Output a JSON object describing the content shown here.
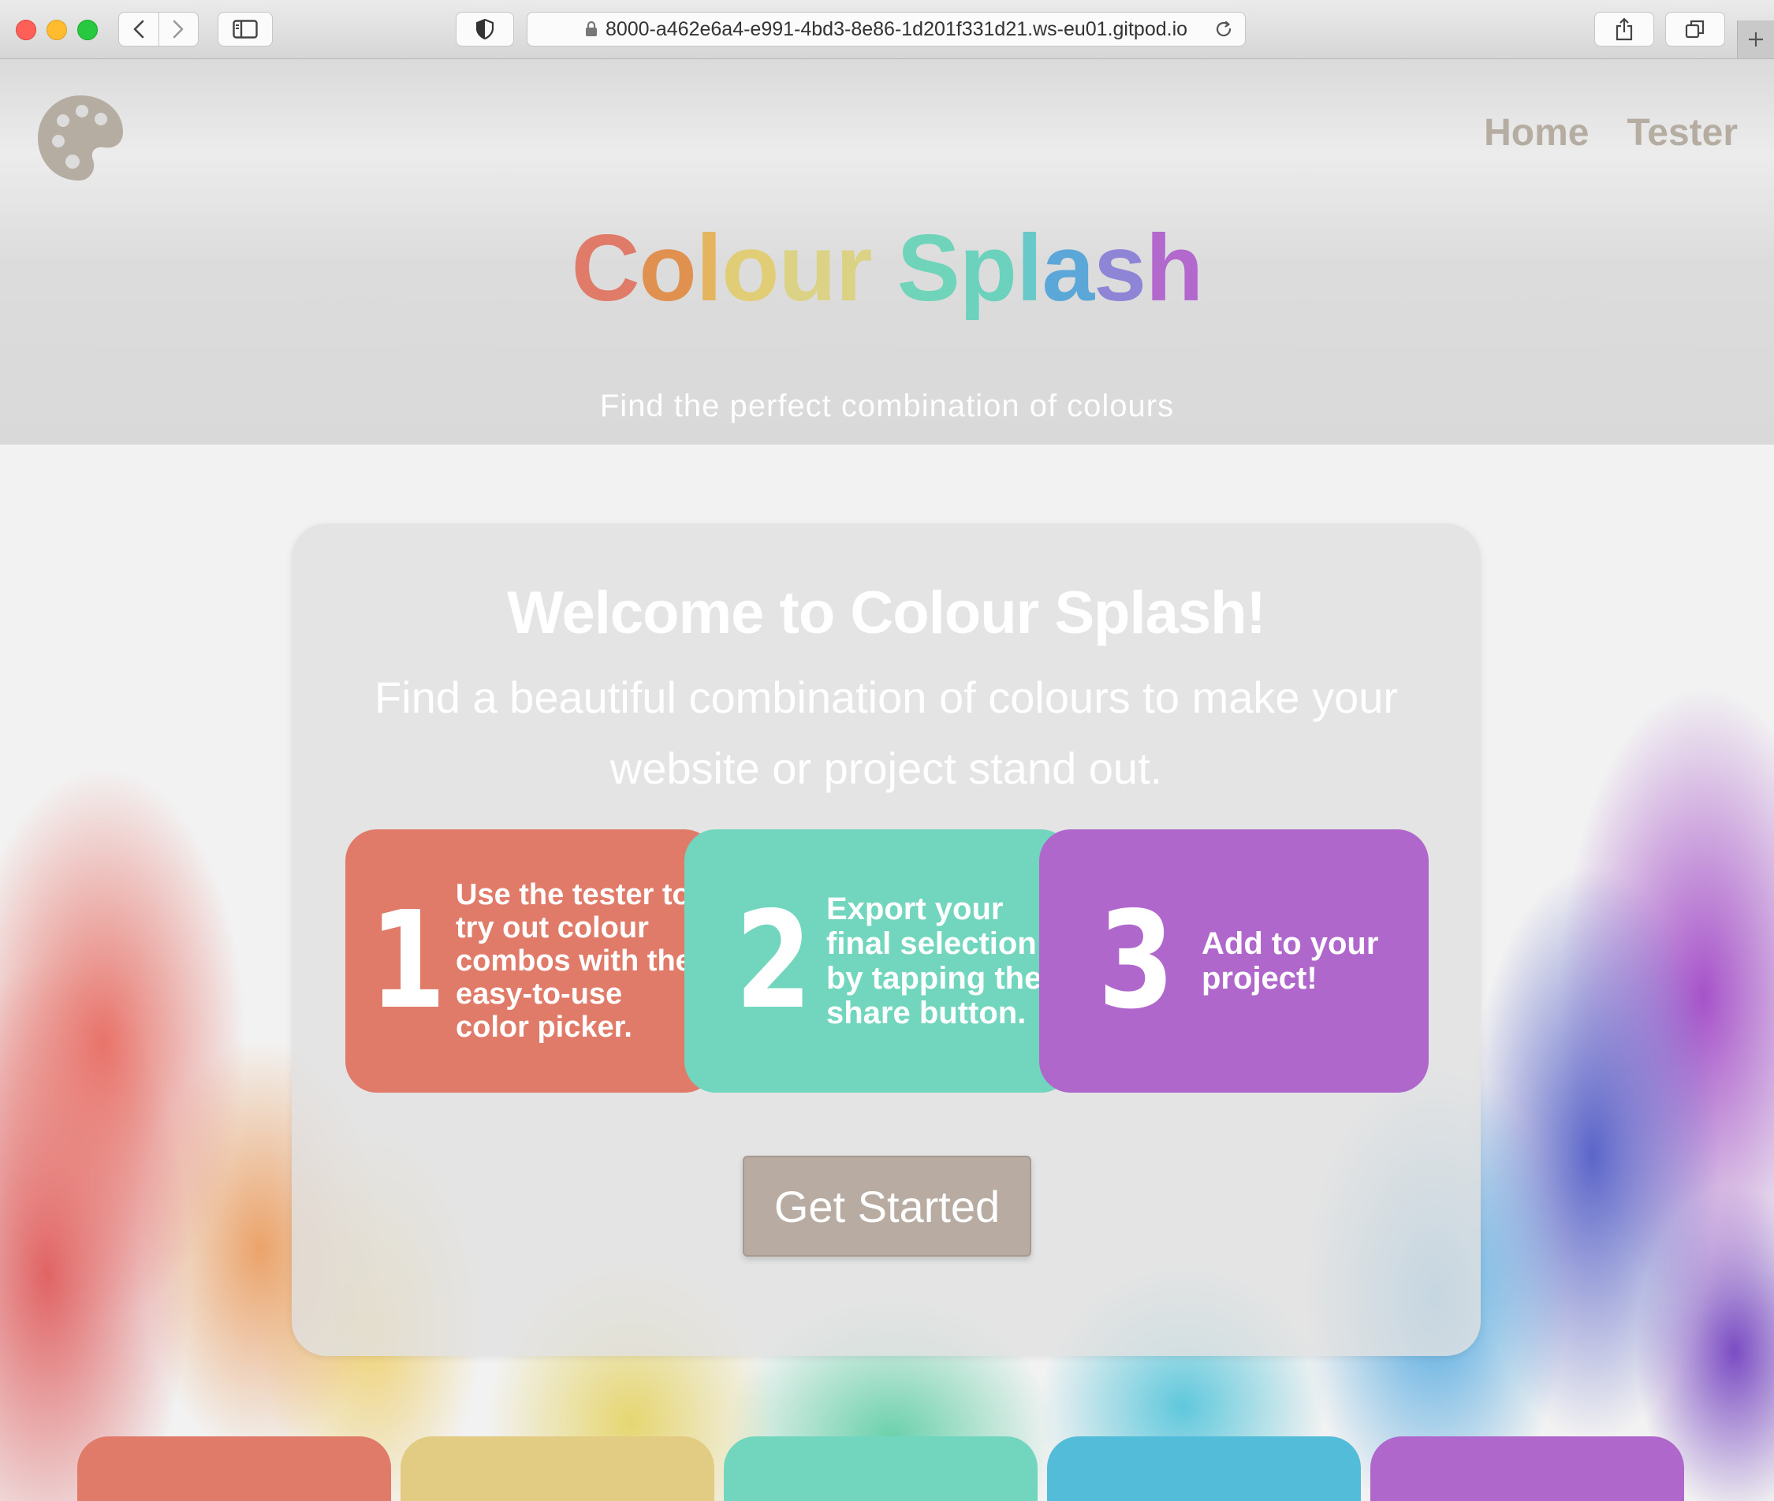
{
  "browser": {
    "url": "8000-a462e6a4-e991-4bd3-8e86-1d201f331d21.ws-eu01.gitpod.io"
  },
  "nav": {
    "home": "Home",
    "tester": "Tester"
  },
  "header": {
    "brand_letters": [
      "C",
      "o",
      "l",
      "o",
      "u",
      "r",
      " ",
      "S",
      "p",
      "l",
      "a",
      "s",
      "h"
    ],
    "brand_text": "Colour Splash",
    "tagline": "Find the perfect combination of colours"
  },
  "hero": {
    "title": "Welcome to Colour Splash!",
    "intro": "Find a beautiful combination of colours to make your website or project stand out.",
    "steps": [
      {
        "number": "1",
        "text": "Use the tester to try out colour combos with the easy-to-use color picker.",
        "color": "#e07b6a"
      },
      {
        "number": "2",
        "text": "Export your final selection by tapping the share button.",
        "color": "#72d6be"
      },
      {
        "number": "3",
        "text": "Add to your project!",
        "color": "#b067cc"
      }
    ],
    "cta": "Get Started"
  },
  "palette_tiles": [
    "#e07b6a",
    "#e2cb82",
    "#72d6be",
    "#52bcd9",
    "#b067cc"
  ],
  "colors": {
    "nav_text": "#b5aca2",
    "logo": "#b5aca2",
    "button": "#b8aca2"
  }
}
